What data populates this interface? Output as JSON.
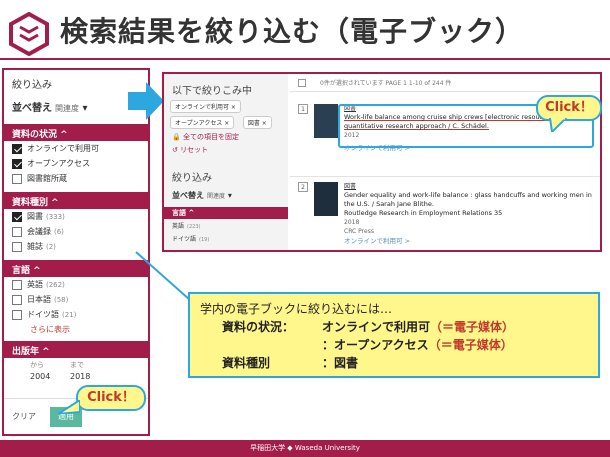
{
  "slide": {
    "title": "検索結果を絞り込む（電子ブック）",
    "footer": "早稲田大学 ◆ Waseda University",
    "accent_color": "#a31d4a",
    "callout_color": "#fff78c",
    "callout_border": "#2da7e0"
  },
  "left_panel": {
    "heading": "絞り込み",
    "sort_label": "並べ替え",
    "sort_value": "関連度",
    "facets": {
      "status": {
        "label": "資料の状況 ^",
        "items": [
          {
            "label": "オンラインで利用可",
            "checked": true
          },
          {
            "label": "オープンアクセス",
            "checked": true
          },
          {
            "label": "図書館所蔵",
            "checked": false
          }
        ]
      },
      "type": {
        "label": "資料種別 ^",
        "items": [
          {
            "label": "図書",
            "count": "(333)",
            "checked": true
          },
          {
            "label": "会議録",
            "count": "(6)",
            "checked": false
          },
          {
            "label": "雑誌",
            "count": "(2)",
            "checked": false
          }
        ]
      },
      "language": {
        "label": "言語 ^",
        "items": [
          {
            "label": "英語",
            "count": "(262)",
            "checked": false
          },
          {
            "label": "日本語",
            "count": "(58)",
            "checked": false
          },
          {
            "label": "ドイツ語",
            "count": "(21)",
            "checked": false
          }
        ],
        "more": "さらに表示"
      },
      "year": {
        "label": "出版年 ^",
        "from_label": "から",
        "to_label": "まで",
        "from_value": "2004",
        "to_value": "2018"
      }
    },
    "clear_label": "クリア",
    "apply_label": "適用"
  },
  "right_shot": {
    "side": {
      "heading": "以下で絞りこみ中",
      "chips": [
        "オンラインで利用可 ×",
        "オープンアクセス ×",
        "図書 ×"
      ],
      "keep_label": "全ての項目を固定",
      "reset_label": "リセット",
      "heading2": "絞り込み",
      "sort_label": "並べ替え",
      "sort_value": "関連度",
      "lang_bar": "言語 ^",
      "lang_items": [
        {
          "label": "英語",
          "count": "(223)"
        },
        {
          "label": "ドイツ語",
          "count": "(19)"
        }
      ]
    },
    "toolbar": "0件が選択されています  PAGE 1  1-10 of 244 件",
    "results": [
      {
        "num": "1",
        "type": "図書",
        "title": "Work-life balance among cruise ship crews [electronic resource] : a quantitative research approach / C. Schädel.",
        "year": "2012",
        "online": "オンラインで利用可 >"
      },
      {
        "num": "2",
        "type": "図書",
        "title": "Gender equality and work-life balance : glass handcuffs and working men in the U.S. / Sarah Jane Blithe.",
        "series": "Routledge Research in Employment Relations 35",
        "year": "2018",
        "publisher": "CRC Press",
        "online": "オンラインで利用可 >"
      }
    ]
  },
  "callouts": {
    "click_top": "Click！",
    "click_bottom": "Click！",
    "info": {
      "intro": "学内の電子ブックに絞り込むには…",
      "row1_label": "資料の状況：",
      "row1_value": "オンラインで利用可",
      "row1_accent": "（＝電子媒体）",
      "row2_value": "：オープンアクセス",
      "row2_accent": "（＝電子媒体）",
      "row3_label": "資料種別",
      "row3_value": "：図書"
    }
  }
}
